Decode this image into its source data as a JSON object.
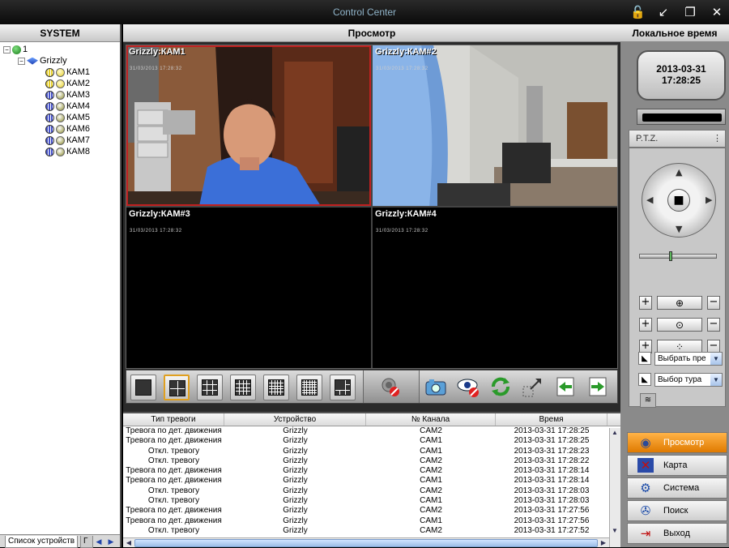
{
  "window": {
    "title": "Control Center"
  },
  "left": {
    "header": "SYSTEM",
    "tree": {
      "root": "1",
      "dvr": "Grizzly",
      "cameras": [
        "КАМ1",
        "КАМ2",
        "КАМ3",
        "КАМ4",
        "КАМ5",
        "КАМ6",
        "КАМ7",
        "КАМ8"
      ]
    },
    "tabs": [
      "Список устройств",
      "Г"
    ]
  },
  "center": {
    "header": "Просмотр",
    "tiles": [
      {
        "label": "Grizzly:КАМ1",
        "timestamp": "31/03/2013 17:28:32"
      },
      {
        "label": "Grizzly:КАМ#2",
        "timestamp": "31/03/2013 17:28:32"
      },
      {
        "label": "Grizzly:КАМ#3",
        "timestamp": "31/03/2013 17:28:32"
      },
      {
        "label": "Grizzly:КАМ#4",
        "timestamp": "31/03/2013 17:28:32"
      }
    ]
  },
  "alarm": {
    "columns": [
      "Тип тревоги",
      "Устройство",
      "№ Канала",
      "Время"
    ],
    "rows": [
      [
        "Тревога по дет. движения",
        "Grizzly",
        "CAM2",
        "2013-03-31 17:28:25"
      ],
      [
        "Тревога по дет. движения",
        "Grizzly",
        "CAM1",
        "2013-03-31 17:28:25"
      ],
      [
        "Откл. тревогу",
        "Grizzly",
        "CAM1",
        "2013-03-31 17:28:23"
      ],
      [
        "Откл. тревогу",
        "Grizzly",
        "CAM2",
        "2013-03-31 17:28:22"
      ],
      [
        "Тревога по дет. движения",
        "Grizzly",
        "CAM2",
        "2013-03-31 17:28:14"
      ],
      [
        "Тревога по дет. движения",
        "Grizzly",
        "CAM1",
        "2013-03-31 17:28:14"
      ],
      [
        "Откл. тревогу",
        "Grizzly",
        "CAM2",
        "2013-03-31 17:28:03"
      ],
      [
        "Откл. тревогу",
        "Grizzly",
        "CAM1",
        "2013-03-31 17:28:03"
      ],
      [
        "Тревога по дет. движения",
        "Grizzly",
        "CAM2",
        "2013-03-31 17:27:56"
      ],
      [
        "Тревога по дет. движения",
        "Grizzly",
        "CAM1",
        "2013-03-31 17:27:56"
      ],
      [
        "Откл. тревогу",
        "Grizzly",
        "CAM2",
        "2013-03-31 17:27:52"
      ]
    ]
  },
  "right": {
    "header": "Локальное время",
    "date": "2013-03-31",
    "time": "17:28:25",
    "ptz_label": "P.T.Z.",
    "preset_select": "Выбрать пре",
    "tour_select": "Выбор тура",
    "nav": [
      {
        "label": "Просмотр",
        "icon": "eye-icon",
        "active": true
      },
      {
        "label": "Карта",
        "icon": "map-icon"
      },
      {
        "label": "Система",
        "icon": "gear-icon"
      },
      {
        "label": "Поиск",
        "icon": "film-reel-icon"
      },
      {
        "label": "Выход",
        "icon": "exit-door-icon"
      }
    ]
  }
}
